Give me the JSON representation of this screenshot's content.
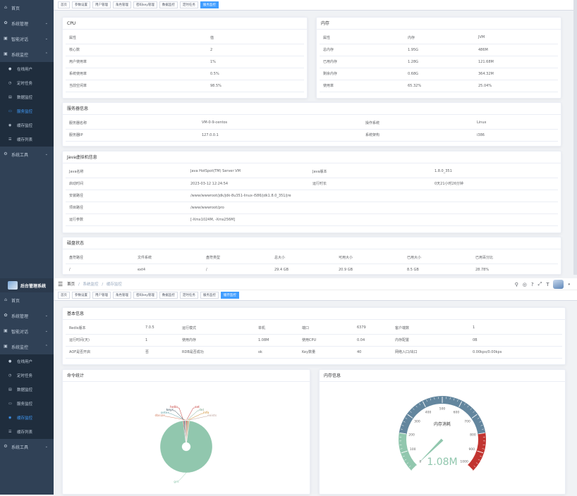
{
  "sidebar1": {
    "items": [
      {
        "icon": "home-icon",
        "label": "首页"
      },
      {
        "icon": "gear-icon",
        "label": "系统管理"
      },
      {
        "icon": "monitor-icon",
        "label": "智能对话"
      },
      {
        "icon": "monitor-icon",
        "label": "系统监控"
      }
    ],
    "sub": [
      {
        "label": "在线用户",
        "active": false
      },
      {
        "label": "定时任务",
        "active": false
      },
      {
        "label": "数据监控",
        "active": false
      },
      {
        "label": "服务监控",
        "active": true
      },
      {
        "label": "缓存监控",
        "active": false
      },
      {
        "label": "缓存列表",
        "active": false
      }
    ],
    "tools": "系统工具"
  },
  "sidebar2": {
    "logo_title": "后台管理系统",
    "items": [
      {
        "icon": "home-icon",
        "label": "首页"
      },
      {
        "icon": "gear-icon",
        "label": "系统管理"
      },
      {
        "icon": "monitor-icon",
        "label": "智能对话"
      },
      {
        "icon": "monitor-icon",
        "label": "系统监控"
      }
    ],
    "sub": [
      {
        "label": "在线用户",
        "active": false
      },
      {
        "label": "定时任务",
        "active": false
      },
      {
        "label": "数据监控",
        "active": false
      },
      {
        "label": "服务监控",
        "active": false
      },
      {
        "label": "缓存监控",
        "active": true
      },
      {
        "label": "缓存列表",
        "active": false
      }
    ],
    "tools": "系统工具"
  },
  "tags1": [
    {
      "label": "首页",
      "active": false
    },
    {
      "label": "参数设置",
      "active": false
    },
    {
      "label": "用户管理",
      "active": false
    },
    {
      "label": "角色管理",
      "active": false
    },
    {
      "label": "密码key管理",
      "active": false
    },
    {
      "label": "数据监控",
      "active": false
    },
    {
      "label": "定时任务",
      "active": false
    },
    {
      "label": "服务监控",
      "active": true
    }
  ],
  "tags2": [
    {
      "label": "首页",
      "active": false
    },
    {
      "label": "参数设置",
      "active": false
    },
    {
      "label": "用户管理",
      "active": false
    },
    {
      "label": "角色管理",
      "active": false
    },
    {
      "label": "密码key管理",
      "active": false
    },
    {
      "label": "数据监控",
      "active": false
    },
    {
      "label": "定时任务",
      "active": false
    },
    {
      "label": "服务监控",
      "active": false
    },
    {
      "label": "缓存监控",
      "active": true
    }
  ],
  "breadcrumb": {
    "home": "首页",
    "sep": "/",
    "level1": "系统监控",
    "level2": "缓存监控"
  },
  "cpu": {
    "title": "CPU",
    "header": [
      "属性",
      "值"
    ],
    "rows": [
      [
        "核心数",
        "2"
      ],
      [
        "用户使用率",
        "1%"
      ],
      [
        "系统使用率",
        "0.5%"
      ],
      [
        "当前空闲率",
        "98.5%"
      ]
    ]
  },
  "memory": {
    "title": "内存",
    "header": [
      "属性",
      "内存",
      "JVM"
    ],
    "rows": [
      [
        "总内存",
        "1.95G",
        "486M"
      ],
      [
        "已用内存",
        "1.28G",
        "121.68M"
      ],
      [
        "剩余内存",
        "0.68G",
        "364.32M"
      ],
      [
        "使用率",
        "65.32%",
        "25.04%"
      ]
    ]
  },
  "server": {
    "title": "服务器信息",
    "rows": [
      [
        "服务器名称",
        "VM-0-9-centos",
        "操作系统",
        "Linux"
      ],
      [
        "服务器IP",
        "127.0.0.1",
        "系统架构",
        "i386"
      ]
    ]
  },
  "jvm": {
    "title": "Java虚拟机信息",
    "rows": [
      [
        "Java名称",
        "Java HotSpot(TM) Server VM",
        "Java版本",
        "1.8.0_351"
      ],
      [
        "启动时间",
        "2023-03-12 12:24:54",
        "运行时长",
        "0天21小时26分钟"
      ]
    ],
    "install_label": "安装路径",
    "install_value": "/www/wwwroot/jdk/jdk-8u351-linux-i586/jdk1.8.0_351/jre",
    "project_label": "项目路径",
    "project_value": "/www/wwwroot/pro",
    "args_label": "运行参数",
    "args_value": "[-Xmx1024M, -Xms256M]"
  },
  "disk": {
    "title": "磁盘状态",
    "header": [
      "盘符路径",
      "文件系统",
      "盘符类型",
      "总大小",
      "可用大小",
      "已用大小",
      "已用百分比"
    ],
    "rows": [
      [
        "/",
        "ext4",
        "/",
        "29.4 GB",
        "20.9 GB",
        "8.5 GB",
        "28.78%"
      ]
    ]
  },
  "redis": {
    "title": "基本信息",
    "rows": [
      [
        "Redis版本",
        "7.0.5",
        "运行模式",
        "单机",
        "端口",
        "6379",
        "客户端数",
        "1"
      ],
      [
        "运行时间(天)",
        "1",
        "使用内存",
        "1.08M",
        "使用CPU",
        "0.04",
        "内存配置",
        "0B"
      ],
      [
        "AOF是否开启",
        "否",
        "RDB是否成功",
        "ok",
        "Key数量",
        "40",
        "网络入口/出口",
        "0.00kps/0.00kps"
      ]
    ]
  },
  "cmdstats": {
    "title": "命令统计",
    "labels": [
      "hello",
      "keys",
      "setex",
      "dbsize",
      "set",
      "del",
      "info",
      "exists",
      "get"
    ]
  },
  "meminfo": {
    "title": "内存信息",
    "gauge_title": "内存消耗",
    "gauge_value": "1.08M",
    "ticks": [
      "0",
      "100",
      "200",
      "300",
      "400",
      "500",
      "600",
      "700",
      "800",
      "900",
      "1000"
    ]
  },
  "chart_data": [
    {
      "type": "pie",
      "title": "命令统计",
      "categories": [
        "hello",
        "keys",
        "setex",
        "dbsize",
        "set",
        "del",
        "info",
        "exists",
        "get"
      ],
      "values": [
        0.5,
        0.5,
        0.5,
        0.5,
        0.5,
        0.5,
        0.5,
        0.5,
        97
      ]
    },
    {
      "type": "gauge",
      "title": "内存消耗",
      "value": 1.08,
      "ylim": [
        0,
        1000
      ],
      "ticks": [
        0,
        100,
        200,
        300,
        400,
        500,
        600,
        700,
        800,
        900,
        1000
      ]
    }
  ],
  "colors": {
    "sidebar": "#304156",
    "active": "#409eff",
    "pie": "#91c7ae",
    "gauge_low": "#91c7ae",
    "gauge_mid": "#63869e",
    "gauge_high": "#c23531"
  }
}
